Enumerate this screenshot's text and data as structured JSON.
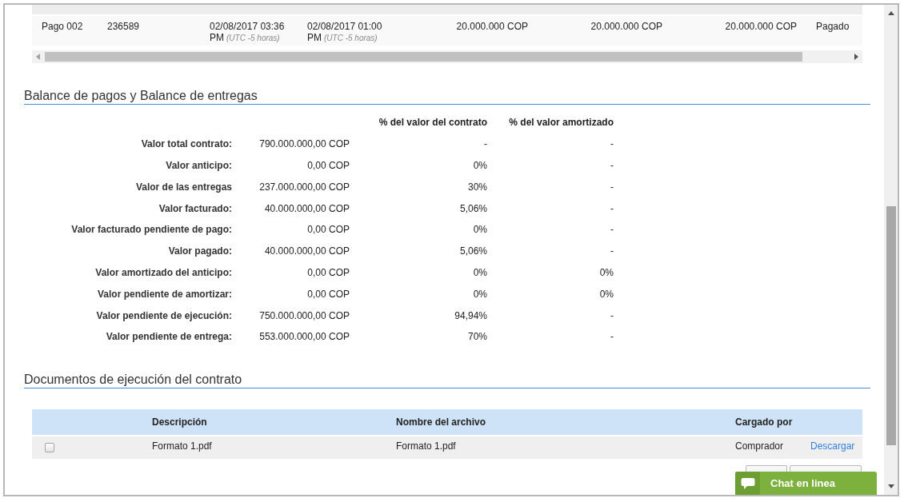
{
  "payments_table": {
    "rows": [
      {
        "cells": [
          {
            "text": "Pago 002"
          },
          {
            "text": "236589"
          },
          {
            "text": "02/08/2017 03:36 PM",
            "note": "(UTC -5 horas)"
          },
          {
            "text": "02/08/2017 01:00 PM",
            "note": "(UTC -5 horas)"
          },
          {
            "text": "20.000.000 COP",
            "kind": "amount"
          },
          {
            "text": "20.000.000 COP",
            "kind": "amount"
          },
          {
            "text": "20.000.000 COP",
            "kind": "amount"
          },
          {
            "text": "Pagado",
            "kind": "status"
          }
        ]
      }
    ]
  },
  "balance": {
    "title": "Balance de pagos y Balance de entregas",
    "columns": [
      "% del valor del contrato",
      "% del valor amortizado"
    ],
    "rows": [
      {
        "label": "Valor total contrato:",
        "value": "790.000.000,00 COP",
        "pct_contract": "-",
        "pct_amortized": "-"
      },
      {
        "label": "Valor anticipo:",
        "value": "0,00 COP",
        "pct_contract": "0%",
        "pct_amortized": "-"
      },
      {
        "label": "Valor de las entregas",
        "value": "237.000.000,00 COP",
        "pct_contract": "30%",
        "pct_amortized": "-"
      },
      {
        "label": "Valor facturado:",
        "value": "40.000.000,00 COP",
        "pct_contract": "5,06%",
        "pct_amortized": "-"
      },
      {
        "label": "Valor facturado pendiente de pago:",
        "value": "0,00 COP",
        "pct_contract": "0%",
        "pct_amortized": "-"
      },
      {
        "label": "Valor pagado:",
        "value": "40.000.000,00 COP",
        "pct_contract": "5,06%",
        "pct_amortized": "-"
      },
      {
        "label": "Valor amortizado del anticipo:",
        "value": "0,00 COP",
        "pct_contract": "0%",
        "pct_amortized": "0%"
      },
      {
        "label": "Valor pendiente de amortizar:",
        "value": "0,00 COP",
        "pct_contract": "0%",
        "pct_amortized": "0%"
      },
      {
        "label": "Valor pendiente de ejecución:",
        "value": "750.000.000,00 COP",
        "pct_contract": "94,94%",
        "pct_amortized": "-"
      },
      {
        "label": "Valor pendiente de entrega:",
        "value": "553.000.000,00 COP",
        "pct_contract": "70%",
        "pct_amortized": "-"
      }
    ]
  },
  "documents": {
    "title": "Documentos de ejecución del contrato",
    "columns": [
      "Descripción",
      "Nombre del archivo",
      "Cargado por"
    ],
    "rows": [
      {
        "checked": false,
        "description": "Formato 1.pdf",
        "file_name": "Formato 1.pdf",
        "uploaded_by": "Comprador",
        "action": "Descargar"
      }
    ]
  },
  "chat": {
    "label": "Chat en linea"
  }
}
